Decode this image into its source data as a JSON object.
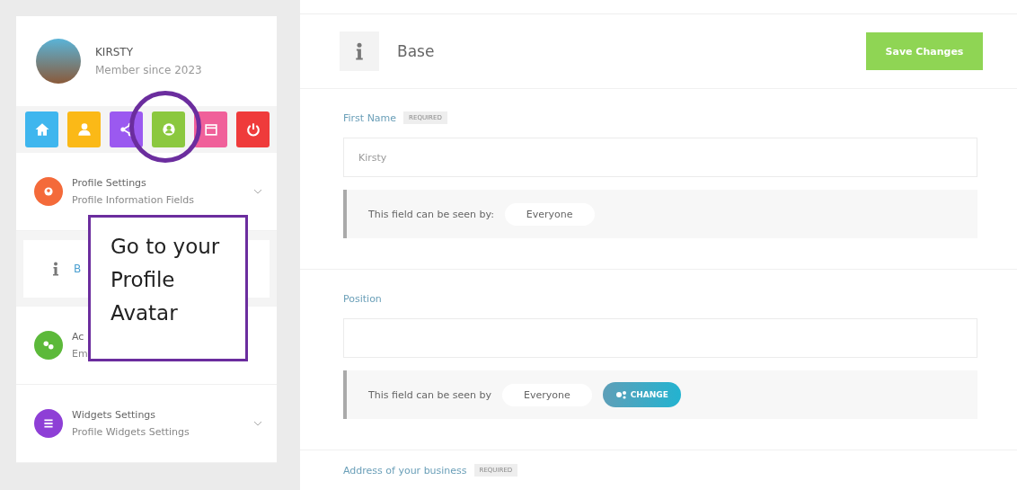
{
  "user": {
    "name": "KIRSTY",
    "member_since": "Member since 2023"
  },
  "quick_buttons": [
    {
      "kind": "home",
      "color": "#3fb6ee"
    },
    {
      "kind": "user",
      "color": "#fbb917"
    },
    {
      "kind": "share",
      "color": "#9b59f0"
    },
    {
      "kind": "avatar",
      "color": "#8bc83f"
    },
    {
      "kind": "calendar",
      "color": "#f0609a"
    },
    {
      "kind": "power",
      "color": "#ef3b3b"
    }
  ],
  "menu": [
    {
      "kind": "profile",
      "title": "Profile Settings",
      "subtitle": "Profile Information Fields",
      "color": "#f46a3a",
      "chevron": true,
      "children": [
        {
          "label": "B"
        }
      ]
    },
    {
      "kind": "account",
      "title": "Ac",
      "subtitle": "Em",
      "color": "#5cb93a",
      "chevron": false
    },
    {
      "kind": "widgets",
      "title": "Widgets Settings",
      "subtitle": "Profile Widgets Settings",
      "color": "#8e3fd6",
      "chevron": true
    }
  ],
  "header": {
    "title": "Base",
    "save_button": "Save Changes"
  },
  "fields": [
    {
      "kind": "input",
      "label": "First Name",
      "badge": "REQUIRED",
      "value": "Kirsty",
      "visibility_label": "This field can be seen by:",
      "visibility": "Everyone"
    },
    {
      "kind": "input",
      "label": "Position",
      "visibility_label": "This field can be seen by",
      "visibility": "Everyone",
      "change_button": "CHANGE"
    },
    {
      "kind": "label",
      "label": "Address of your business",
      "badge": "REQUIRED"
    }
  ],
  "callout": {
    "text": "Go to your Profile Avatar"
  }
}
